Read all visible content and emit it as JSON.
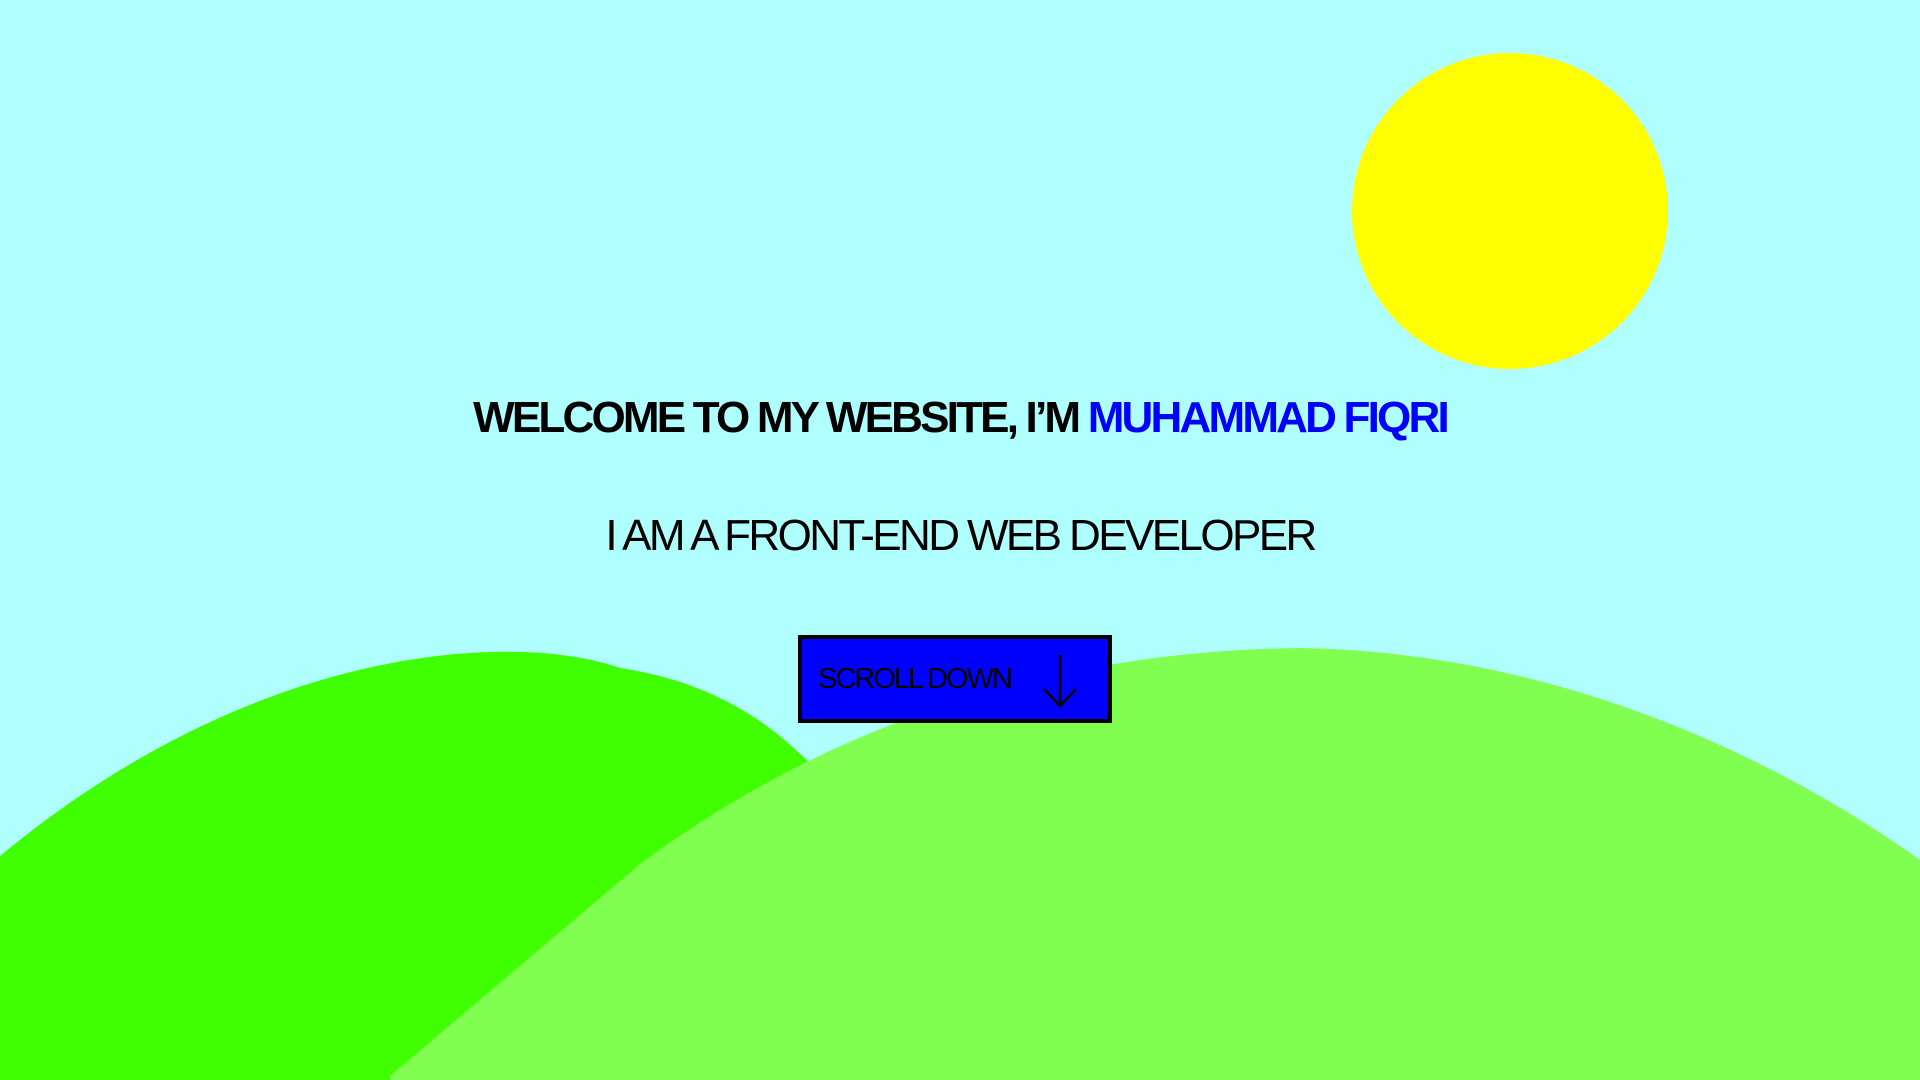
{
  "colors": {
    "sky": "#b0ffff",
    "sun": "#ffff00",
    "hill_back": "#40ff00",
    "hill_front": "#80ff50",
    "accent": "#0000ff",
    "button_bg": "#0000ff",
    "text": "#000000"
  },
  "hero": {
    "title_prefix": "WELCOME TO MY WEBSITE, I’M ",
    "title_name": "MUHAMMAD FIQRI",
    "subtitle": "I AM A FRONT-END WEB DEVELOPER"
  },
  "scroll_button": {
    "label": "SCROLL DOWN",
    "icon": "arrow-down-icon"
  },
  "scenery": {
    "sun_icon": "sun-shape",
    "hills": [
      "back-hill",
      "front-hill"
    ]
  }
}
